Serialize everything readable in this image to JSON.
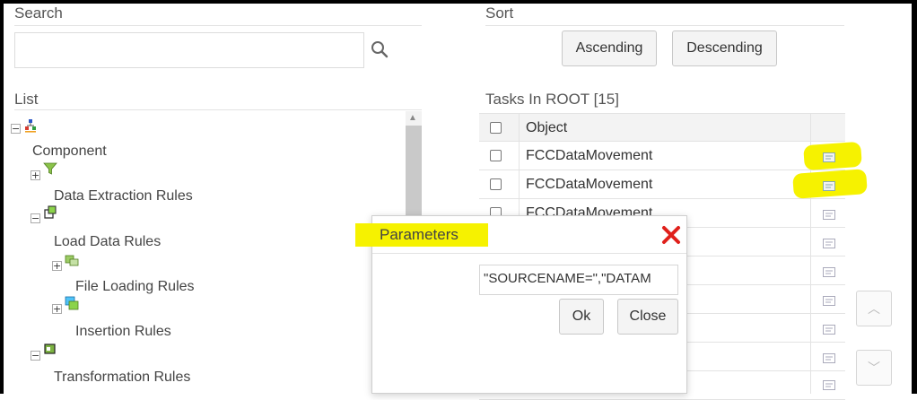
{
  "search": {
    "label": "Search",
    "value": "",
    "icon": "search-icon"
  },
  "sort": {
    "label": "Sort",
    "ascending_label": "Ascending",
    "descending_label": "Descending"
  },
  "list": {
    "label": "List",
    "tree": [
      {
        "label": "Component"
      },
      {
        "label": "Data Extraction Rules"
      },
      {
        "label": "Load Data Rules"
      },
      {
        "label": "File Loading Rules"
      },
      {
        "label": "Insertion Rules"
      },
      {
        "label": "Transformation Rules"
      }
    ]
  },
  "tasks": {
    "title": "Tasks In ROOT [15]",
    "column_object": "Object",
    "rows": [
      {
        "object": "FCCDataMovement"
      },
      {
        "object": "FCCDataMovement"
      },
      {
        "object": "FCCDataMovement"
      }
    ]
  },
  "dialog": {
    "title": "Parameters",
    "value": "\"SOURCENAME=\",\"DATAM",
    "ok_label": "Ok",
    "close_label": "Close"
  },
  "colors": {
    "highlight": "#f6f200",
    "close_red": "#e0201b"
  }
}
